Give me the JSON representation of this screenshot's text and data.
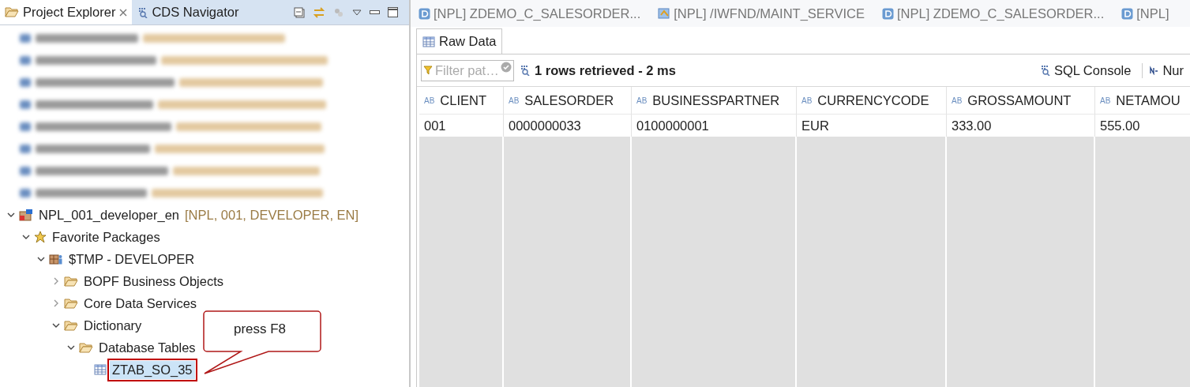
{
  "explorer": {
    "tabs": [
      {
        "label": "Project Explorer",
        "selected": true
      },
      {
        "label": "CDS Navigator",
        "selected": false
      }
    ],
    "hidden_items": [
      {
        "kind": "redacted"
      },
      {
        "kind": "redacted"
      },
      {
        "kind": "redacted"
      },
      {
        "kind": "redacted"
      },
      {
        "kind": "redacted"
      },
      {
        "kind": "redacted"
      },
      {
        "kind": "redacted"
      },
      {
        "kind": "redacted"
      }
    ],
    "tree": [
      {
        "label": "NPL_001_developer_en",
        "suffix": "[NPL, 001, DEVELOPER, EN]",
        "kind": "system",
        "expanded": true,
        "children": [
          {
            "label": "Favorite Packages",
            "kind": "favorites",
            "expanded": true,
            "children": [
              {
                "label": "$TMP - DEVELOPER",
                "kind": "package",
                "expanded": true,
                "children": [
                  {
                    "label": "BOPF Business Objects",
                    "kind": "folder",
                    "expanded": false
                  },
                  {
                    "label": "Core Data Services",
                    "kind": "folder",
                    "expanded": false
                  },
                  {
                    "label": "Dictionary",
                    "kind": "folder",
                    "expanded": true,
                    "children": [
                      {
                        "label": "Database Tables",
                        "kind": "folder",
                        "expanded": true,
                        "children": [
                          {
                            "label": "ZTAB_SO_35",
                            "kind": "table",
                            "selected": true,
                            "framed": true
                          }
                        ]
                      }
                    ]
                  }
                ]
              }
            ]
          }
        ]
      }
    ]
  },
  "callout": {
    "text": "press F8"
  },
  "editor": {
    "tabs": [
      {
        "label": "[NPL] ZDEMO_C_SALESORDER...",
        "kind": "ddl"
      },
      {
        "label": "[NPL] /IWFND/MAINT_SERVICE",
        "kind": "service"
      },
      {
        "label": "[NPL] ZDEMO_C_SALESORDER...",
        "kind": "ddl"
      },
      {
        "label": "[NPL]",
        "kind": "ddl"
      }
    ],
    "view_tabs": [
      {
        "label": "Raw Data",
        "selected": true
      }
    ],
    "filter": {
      "placeholder": "Filter pat…"
    },
    "status": "1 rows retrieved - 2 ms",
    "actions": [
      {
        "label": "SQL Console",
        "kind": "sql"
      },
      {
        "label": "Nur",
        "kind": "number"
      }
    ],
    "table": {
      "columns": [
        {
          "type": "AB",
          "label": "CLIENT"
        },
        {
          "type": "AB",
          "label": "SALESORDER"
        },
        {
          "type": "AB",
          "label": "BUSINESSPARTNER"
        },
        {
          "type": "AB",
          "label": "CURRENCYCODE"
        },
        {
          "type": "AB",
          "label": "GROSSAMOUNT"
        },
        {
          "type": "AB",
          "label": "NETAMOU"
        }
      ],
      "rows": [
        [
          "001",
          "0000000033",
          "0100000001",
          "EUR",
          "333.00",
          "555.00"
        ]
      ]
    }
  }
}
